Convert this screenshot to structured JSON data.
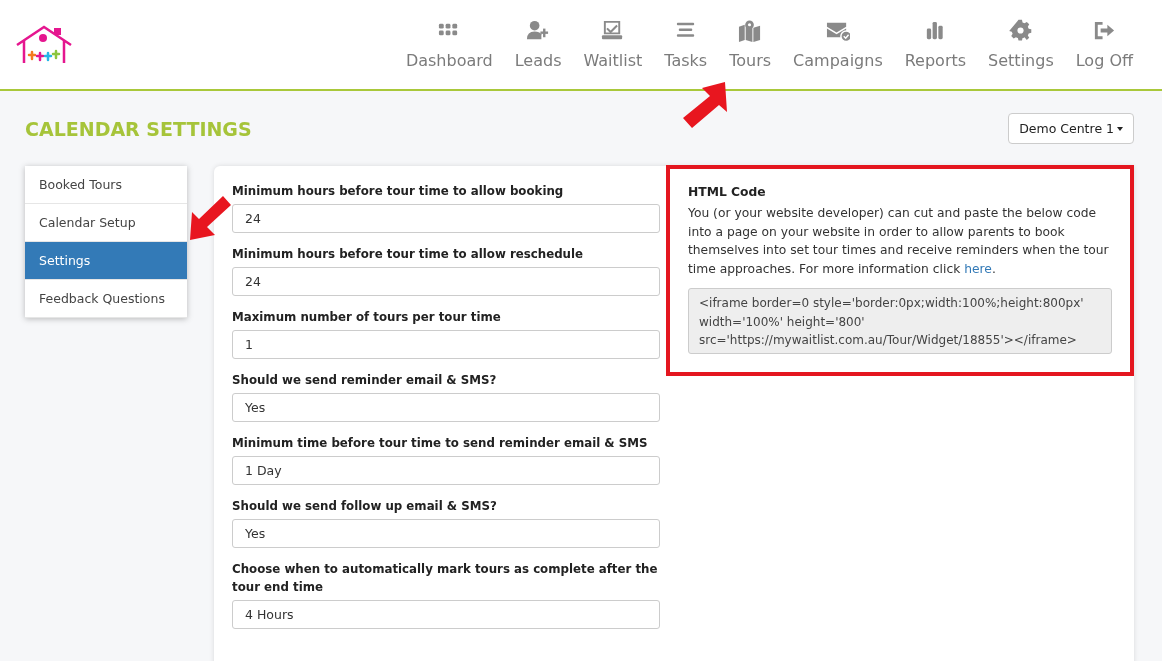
{
  "nav": [
    {
      "label": "Dashboard"
    },
    {
      "label": "Leads"
    },
    {
      "label": "Waitlist"
    },
    {
      "label": "Tasks"
    },
    {
      "label": "Tours"
    },
    {
      "label": "Campaigns"
    },
    {
      "label": "Reports"
    },
    {
      "label": "Settings"
    },
    {
      "label": "Log Off"
    }
  ],
  "title": "CALENDAR SETTINGS",
  "centre_select": {
    "value": "Demo Centre 1"
  },
  "side_menu": [
    {
      "label": "Booked Tours",
      "selected": false
    },
    {
      "label": "Calendar Setup",
      "selected": false
    },
    {
      "label": "Settings",
      "selected": true
    },
    {
      "label": "Feedback Questions",
      "selected": false
    }
  ],
  "fields": [
    {
      "label": "Minimum hours before tour time to allow booking",
      "value": "24"
    },
    {
      "label": "Minimum hours before tour time to allow reschedule",
      "value": "24"
    },
    {
      "label": "Maximum number of tours per tour time",
      "value": "1"
    },
    {
      "label": "Should we send reminder email & SMS?",
      "value": "Yes"
    },
    {
      "label": "Minimum time before tour time to send reminder email & SMS",
      "value": "1 Day"
    },
    {
      "label": "Should we send follow up email & SMS?",
      "value": "Yes"
    },
    {
      "label": "Choose when to automatically mark tours as complete after the tour end time",
      "value": "4 Hours"
    }
  ],
  "html_code": {
    "heading": "HTML Code",
    "text": "You (or your website developer) can cut and paste the below code into a page on your website in order to allow parents to book themselves into set tour times and receive reminders when the tour time approaches. For more information click ",
    "link": "here",
    "text_end": ".",
    "code": "<iframe border=0 style='border:0px;width:100%;height:800px' width='100%' height='800' src='https://mywaitlist.com.au/Tour/Widget/18855'></iframe>"
  }
}
